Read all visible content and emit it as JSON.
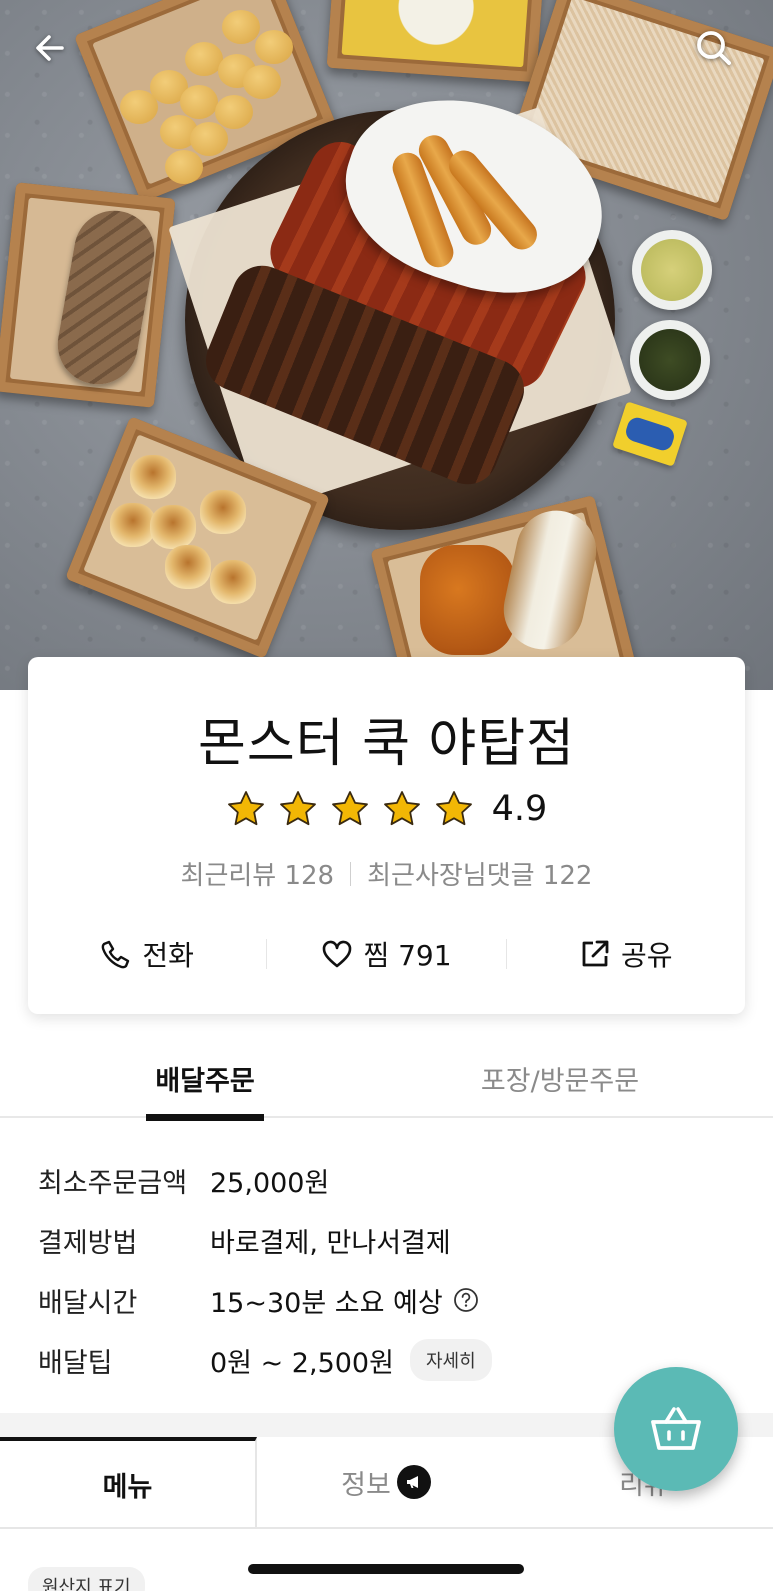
{
  "hero": {
    "back_icon": "arrow-left-icon",
    "search_icon": "search-icon"
  },
  "store": {
    "name": "몬스터 쿡 야탑점",
    "rating": 4.9,
    "rating_text": "4.9",
    "star_count": 5,
    "star_color": "#f2b705",
    "recent_reviews": "최근리뷰 128",
    "recent_owner_replies": "최근사장님댓글 122"
  },
  "actions": {
    "call_label": "전화",
    "favorite_label": "찜 791",
    "share_label": "공유"
  },
  "order_tabs": {
    "delivery": "배달주문",
    "pickup": "포장/방문주문",
    "active": "delivery"
  },
  "delivery_info": {
    "rows": [
      {
        "key": "최소주문금액",
        "value": "25,000원"
      },
      {
        "key": "결제방법",
        "value": "바로결제, 만나서결제"
      },
      {
        "key": "배달시간",
        "value": "15~30분 소요 예상"
      },
      {
        "key": "배달팁",
        "value": "0원 ~ 2,500원"
      }
    ],
    "tip_detail_label": "자세히"
  },
  "bottom_tabs": {
    "menu": "메뉴",
    "info": "정보",
    "reviews": "리뷰",
    "active": "menu"
  },
  "origin_label": "원산지 표기",
  "colors": {
    "accent_fab": "#5bbab5",
    "active_tab": "#111111",
    "muted_text": "#8a8a8a"
  }
}
